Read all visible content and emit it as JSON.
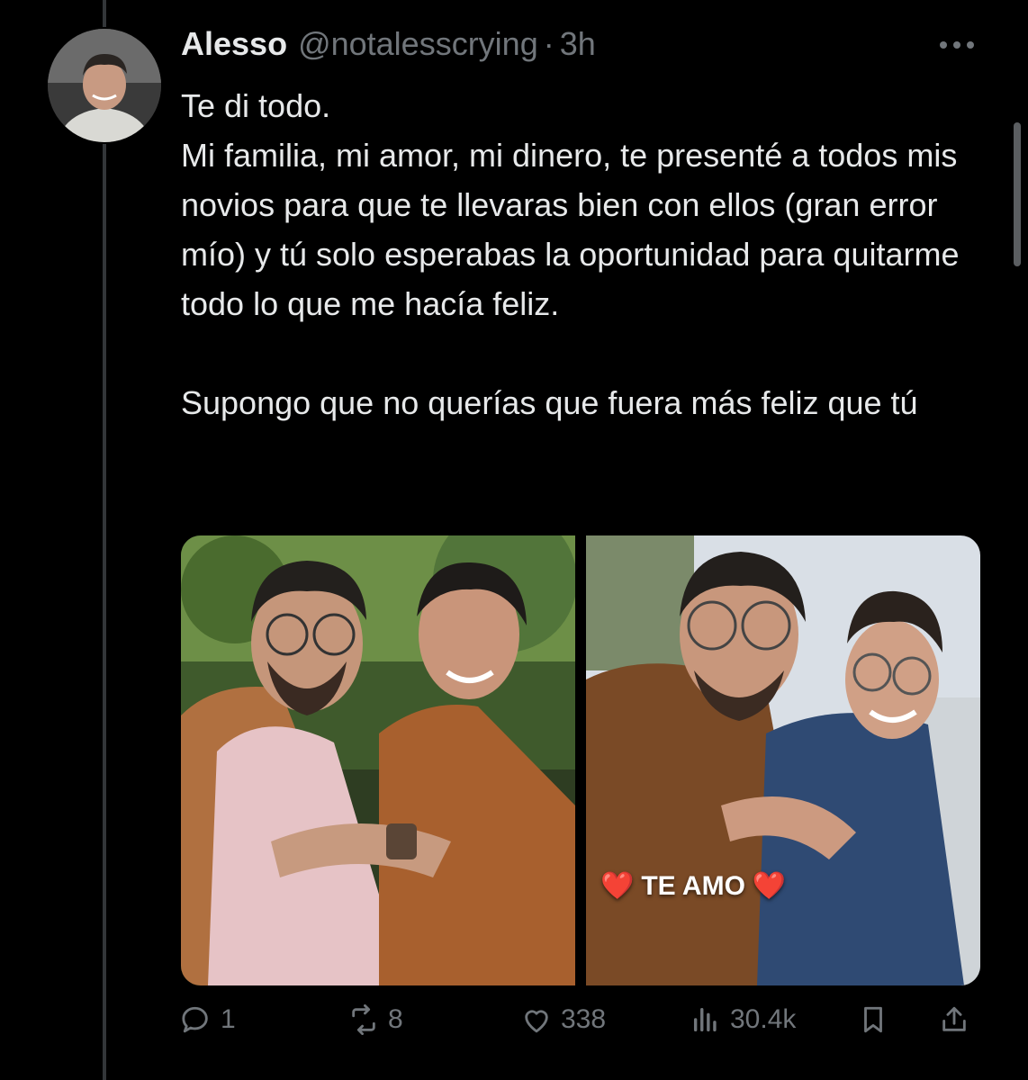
{
  "tweet": {
    "author_name": "Alesso",
    "author_handle": "@notalesscrying",
    "separator": "·",
    "time": "3h",
    "text": "Te di todo.\nMi familia, mi amor, mi dinero, te presenté a todos mis novios para que te llevaras bien con ellos (gran error mío) y tú solo esperabas la oportunidad para quitarme todo lo que me hacía feliz.\n\nSupongo que no querías que fuera más feliz que tú"
  },
  "media": {
    "caption_text": "TE AMO",
    "caption_emoji_left": "❤️",
    "caption_emoji_right": "❤️"
  },
  "actions": {
    "replies": "1",
    "reposts": "8",
    "likes": "338",
    "views": "30.4k"
  },
  "icons": {
    "reply": "reply-icon",
    "repost": "repost-icon",
    "like": "heart-icon",
    "views": "views-icon",
    "bookmark": "bookmark-icon",
    "share": "share-icon",
    "more": "more-icon"
  },
  "colors": {
    "background": "#000000",
    "text": "#e7e9ea",
    "secondary": "#71767b"
  }
}
